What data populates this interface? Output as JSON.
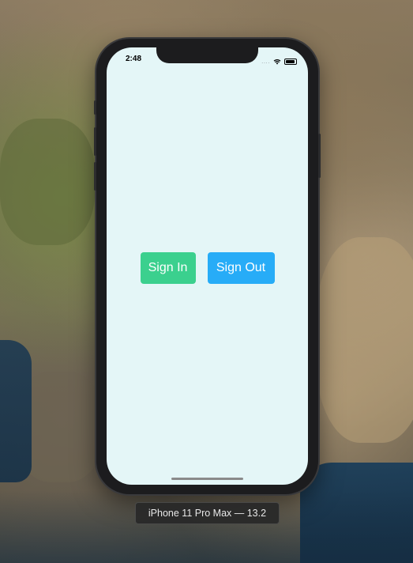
{
  "status_bar": {
    "time": "2:48",
    "signal": "....",
    "wifi_icon": "wifi-icon",
    "battery_icon": "battery-icon"
  },
  "app": {
    "background_color": "#e4f6f7",
    "buttons": {
      "sign_in": {
        "label": "Sign In",
        "color": "#3bd08e"
      },
      "sign_out": {
        "label": "Sign Out",
        "color": "#27acf7"
      }
    }
  },
  "simulator": {
    "device_label": "iPhone 11 Pro Max — 13.2"
  }
}
